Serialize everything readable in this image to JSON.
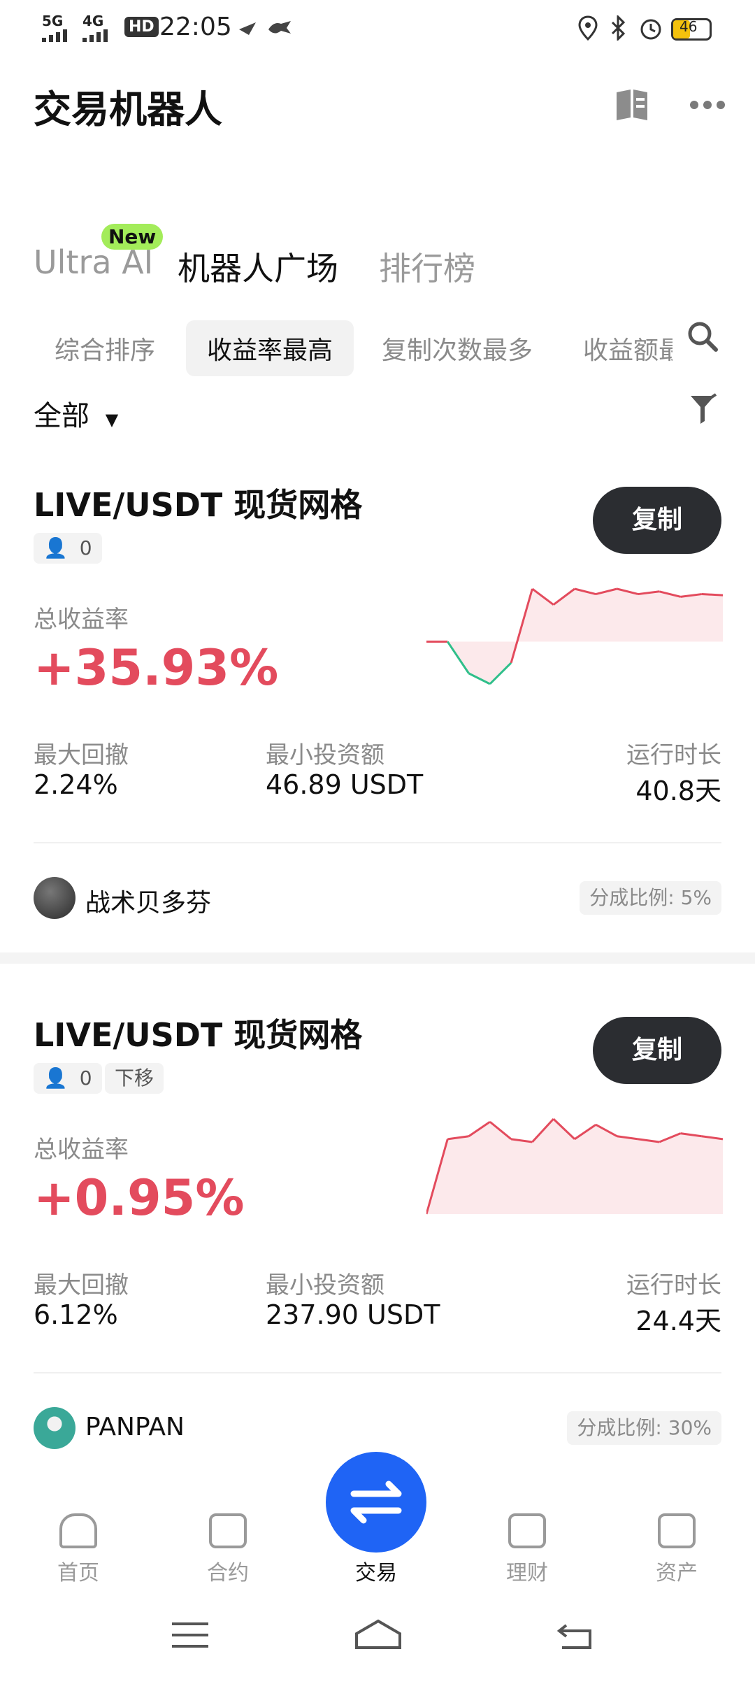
{
  "status_bar": {
    "net1": "5G",
    "net2": "4G",
    "hd": "HD",
    "time": "22:05",
    "battery": "46"
  },
  "header": {
    "title": "交易机器人"
  },
  "top_tabs": [
    {
      "label": "Ultra AI",
      "badge": "New"
    },
    {
      "label": "机器人广场"
    },
    {
      "label": "排行榜"
    }
  ],
  "sub_tabs": [
    "综合排序",
    "收益率最高",
    "复制次数最多",
    "收益额最"
  ],
  "filter": {
    "label": "全部"
  },
  "cards": [
    {
      "title": "LIVE/USDT  现货网格",
      "users": "0",
      "tag": "",
      "copy_label": "复制",
      "yield_label": "总收益率",
      "yield_value": "+35.93%",
      "dd_label": "最大回撤",
      "dd_value": "2.24%",
      "min_label": "最小投资额",
      "min_value": "46.89 USDT",
      "run_label": "运行时长",
      "run_value": "40.8天",
      "author": "战术贝多芬",
      "share": "分成比例: 5%",
      "spark": [
        0,
        0,
        -0.6,
        -0.8,
        -0.4,
        1.0,
        0.7,
        1.0,
        0.9,
        1.0,
        0.9,
        0.95,
        0.85,
        0.9,
        0.88
      ]
    },
    {
      "title": "LIVE/USDT  现货网格",
      "users": "0",
      "tag": "下移",
      "copy_label": "复制",
      "yield_label": "总收益率",
      "yield_value": "+0.95%",
      "dd_label": "最大回撤",
      "dd_value": "6.12%",
      "min_label": "最小投资额",
      "min_value": "237.90 USDT",
      "run_label": "运行时长",
      "run_value": "24.4天",
      "author": "PANPAN",
      "share": "分成比例: 30%",
      "spark": [
        -1.0,
        0.3,
        0.35,
        0.6,
        0.3,
        0.25,
        0.65,
        0.3,
        0.55,
        0.35,
        0.3,
        0.25,
        0.4,
        0.35,
        0.3
      ]
    }
  ],
  "bottom_nav": [
    {
      "label": "首页",
      "icon": "home-icon"
    },
    {
      "label": "合约",
      "icon": "chart-icon"
    },
    {
      "label": "交易",
      "icon": "swap-icon"
    },
    {
      "label": "理财",
      "icon": "diamond-icon"
    },
    {
      "label": "资产",
      "icon": "wallet-icon"
    }
  ],
  "colors": {
    "up": "#e34b5d",
    "down": "#2fbf8a",
    "fab": "#1f64f5"
  }
}
